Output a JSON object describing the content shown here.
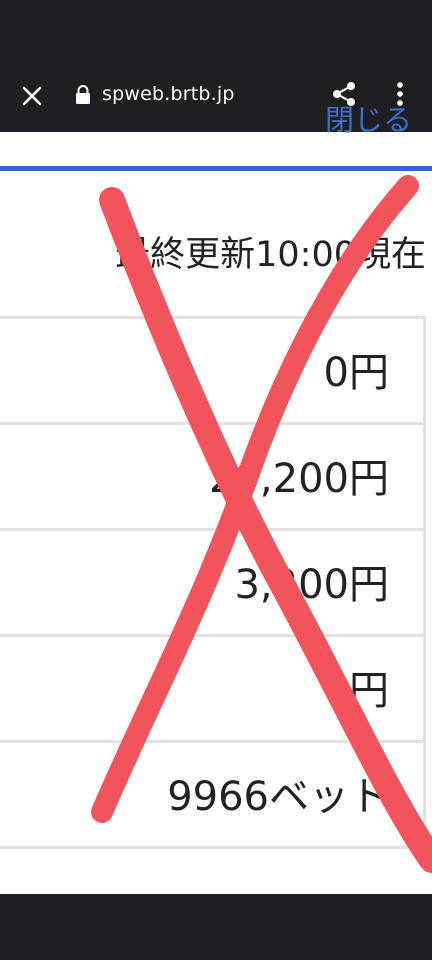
{
  "browser": {
    "url": "spweb.brtb.jp",
    "close_icon": "close-icon",
    "lock_icon": "lock-icon",
    "share_icon": "share-icon",
    "menu_icon": "more-vertical-icon"
  },
  "page": {
    "close_link": "閉じる",
    "last_updated": "最終更新10:00現在",
    "accent_color": "#3366cc"
  },
  "table": {
    "rows": [
      {
        "value": "0円"
      },
      {
        "value": "20,200円"
      },
      {
        "value": "3,200円"
      },
      {
        "value": "0円"
      },
      {
        "value": "9966ベット"
      }
    ]
  },
  "overlay": {
    "mark": "red-x-mark",
    "color": "#f2545b"
  }
}
